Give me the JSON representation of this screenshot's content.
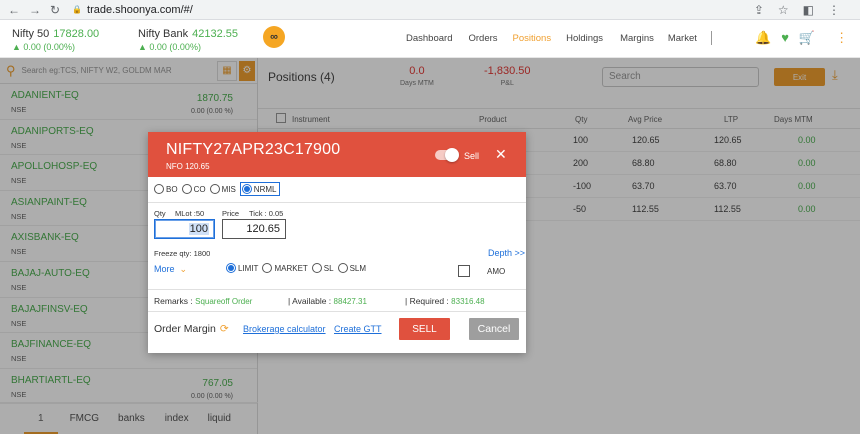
{
  "browser": {
    "url": "trade.shoonya.com/#/",
    "back_icon": "←",
    "forward_icon": "→",
    "reload_icon": "↻",
    "lock_icon": "🔒",
    "share_icon": "⇪",
    "star_icon": "☆",
    "tab_icon": "◧",
    "menu_icon": "⋮"
  },
  "header": {
    "nifty50": {
      "name": "Nifty 50",
      "value": "17828.00",
      "change": "▲ 0.00 (0.00%)"
    },
    "niftybank": {
      "name": "Nifty Bank",
      "value": "42132.55",
      "change": "▲ 0.00 (0.00%)"
    },
    "logo": "∞",
    "nav": [
      "Dashboard",
      "Orders",
      "Positions",
      "Holdings",
      "Margins",
      "Market"
    ],
    "active_nav": "Positions",
    "icons": {
      "bell": "🔔",
      "heart": "♥",
      "cart": "🛒",
      "more": "⋮"
    }
  },
  "watchlist": {
    "search_placeholder": "Search eg:TCS, NIFTY W2, GOLDM MAR",
    "items": [
      {
        "symbol": "ADANIENT-EQ",
        "exchange": "NSE",
        "ltp": "1870.75",
        "change": "0.00 (0.00 %)"
      },
      {
        "symbol": "ADANIPORTS-EQ",
        "exchange": "NSE",
        "ltp": "",
        "change": ""
      },
      {
        "symbol": "APOLLOHOSP-EQ",
        "exchange": "NSE",
        "ltp": "",
        "change": ""
      },
      {
        "symbol": "ASIANPAINT-EQ",
        "exchange": "NSE",
        "ltp": "",
        "change": ""
      },
      {
        "symbol": "AXISBANK-EQ",
        "exchange": "NSE",
        "ltp": "",
        "change": ""
      },
      {
        "symbol": "BAJAJ-AUTO-EQ",
        "exchange": "NSE",
        "ltp": "",
        "change": ""
      },
      {
        "symbol": "BAJAJFINSV-EQ",
        "exchange": "NSE",
        "ltp": "",
        "change": ""
      },
      {
        "symbol": "BAJFINANCE-EQ",
        "exchange": "NSE",
        "ltp": "",
        "change": ""
      },
      {
        "symbol": "BHARTIARTL-EQ",
        "exchange": "NSE",
        "ltp": "767.05",
        "change": "0.00 (0.00 %)"
      }
    ],
    "tabs": [
      "1",
      "FMCG",
      "banks",
      "index",
      "liquid"
    ]
  },
  "positions": {
    "title": "Positions (4)",
    "days_mtm": {
      "value": "0.0",
      "label": "Days MTM"
    },
    "pnl": {
      "value": "-1,830.50",
      "label": "P&L"
    },
    "search_placeholder": "Search",
    "exit_label": "Exit",
    "download_icon": "⤓",
    "columns": [
      "Instrument",
      "Product",
      "Qty",
      "Avg Price",
      "LTP",
      "Days MTM"
    ],
    "rows": [
      {
        "qty": "100",
        "avg": "120.65",
        "ltp": "120.65",
        "mtm": "0.00"
      },
      {
        "qty": "200",
        "avg": "68.80",
        "ltp": "68.80",
        "mtm": "0.00"
      },
      {
        "qty": "-100",
        "avg": "63.70",
        "ltp": "63.70",
        "mtm": "0.00"
      },
      {
        "qty": "-50",
        "avg": "112.55",
        "ltp": "112.55",
        "mtm": "0.00"
      }
    ]
  },
  "order": {
    "symbol": "NIFTY27APR23C17900",
    "subtitle": "NFO 120.65",
    "side_label": "Sell",
    "close_icon": "✕",
    "product_types": [
      "BO",
      "CO",
      "MIS",
      "NRML"
    ],
    "product_selected": "NRML",
    "qty_label": "Qty",
    "mlot_label": "MLot :50",
    "qty_value": "100",
    "price_label": "Price",
    "tick_label": "Tick : 0.05",
    "price_value": "120.65",
    "freeze_qty": "Freeze qty: 1800",
    "depth_link": "Depth >>",
    "more_label": "More",
    "more_icon": "⌄",
    "order_types": [
      "LIMIT",
      "MARKET",
      "SL",
      "SLM"
    ],
    "order_type_selected": "LIMIT",
    "amo_label": "AMO",
    "remarks_label": "Remarks :",
    "remarks_value": "Squareoff Order",
    "available_label": "| Available :",
    "available_value": "88427.31",
    "required_label": "| Required :",
    "required_value": "83316.48",
    "order_margin_label": "Order Margin",
    "refresh_icon": "⟳",
    "brokerage_link": "Brokerage calculator",
    "gtt_link": "Create GTT",
    "sell_button": "SELL",
    "cancel_button": "Cancel",
    "colors": {
      "header": "#e0513e",
      "accent": "#f0a030",
      "link": "#1e6fd9",
      "positive": "#4caf50"
    }
  }
}
